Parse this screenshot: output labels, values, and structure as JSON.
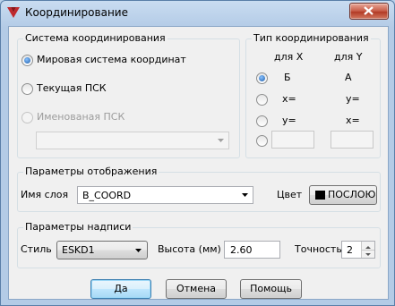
{
  "window": {
    "title": "Координирование",
    "icon": "app-logo-icon",
    "close_icon": "close-icon"
  },
  "coord_system": {
    "title": "Система координирования",
    "options": [
      {
        "label": "Мировая система координат",
        "checked": true,
        "enabled": true
      },
      {
        "label": "Текущая ПСК",
        "checked": false,
        "enabled": true
      },
      {
        "label": "Именованая ПСК",
        "checked": false,
        "enabled": false
      }
    ],
    "ucs_select_value": ""
  },
  "coord_type": {
    "title": "Тип координирования",
    "col_x": "для X",
    "col_y": "для Y",
    "rows": [
      {
        "x": "Б",
        "y": "А",
        "checked": true
      },
      {
        "x": "x=",
        "y": "y=",
        "checked": false
      },
      {
        "x": "y=",
        "y": "x=",
        "checked": false
      },
      {
        "x": "",
        "y": "",
        "checked": false
      }
    ]
  },
  "display": {
    "title": "Параметры отображения",
    "layer_label": "Имя слоя",
    "layer_value": "B_COORD",
    "color_label": "Цвет",
    "color_value": "ПОСЛОЮ",
    "color_swatch": "#000000"
  },
  "label_params": {
    "title": "Параметры надписи",
    "style_label": "Стиль",
    "style_value": "ESKD1",
    "height_label": "Высота (мм)",
    "height_value": "2.60",
    "precision_label": "Точность",
    "precision_value": "2"
  },
  "buttons": {
    "ok": "Да",
    "cancel": "Отмена",
    "help": "Помощь"
  }
}
